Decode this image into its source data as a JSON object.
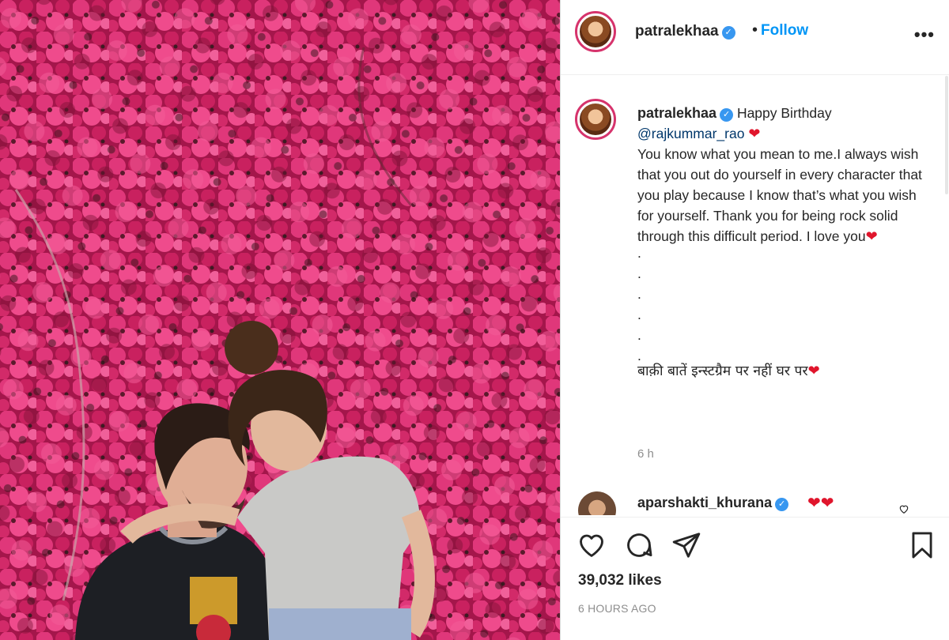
{
  "post": {
    "username": "patralekhaa",
    "follow_label": "Follow",
    "separator": "•",
    "more_label": "•••"
  },
  "caption": {
    "username": "patralekhaa",
    "line1": "Happy Birthday",
    "mention": "@rajkummar_rao",
    "body": "You know what you mean to me.I always wish that you out do yourself in every character that you play because I know that’s what you wish for yourself. Thank you for being rock solid through this difficult period. I love you",
    "dots": [
      ".",
      ".",
      ".",
      ".",
      ".",
      "."
    ],
    "hindi": "बाक़ी बातें इन्स्टग्रैम पर नहीं घर पर",
    "heart": "❤",
    "time": "6 h"
  },
  "comment": {
    "username": "aparshakti_khurana",
    "text": "❤❤"
  },
  "stats": {
    "likes": "39,032 likes",
    "posted": "6 HOURS AGO"
  },
  "icons": {
    "like": "heart-icon",
    "comment": "comment-icon",
    "share": "share-icon",
    "save": "bookmark-icon",
    "more": "more-icon"
  },
  "colors": {
    "accent": "#0095f6",
    "verified": "#3897f0",
    "heart": "#e0152c",
    "text": "#262626",
    "muted": "#8e8e8e"
  }
}
